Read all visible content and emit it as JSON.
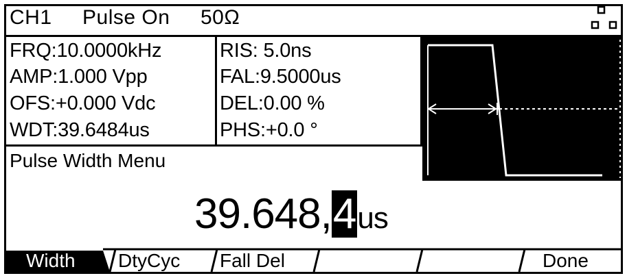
{
  "header": {
    "channel": "CH1",
    "mode": "Pulse On",
    "load": "50Ω"
  },
  "params": {
    "left": [
      {
        "key": "FRQ:",
        "value": "10.0000kHz"
      },
      {
        "key": "AMP:",
        "value": "1.000 Vpp"
      },
      {
        "key": "OFS:",
        "value": "+0.000 Vdc"
      },
      {
        "key": "WDT:",
        "value": "39.6484us"
      }
    ],
    "right": [
      {
        "key": "RIS:",
        "value": " 5.0ns"
      },
      {
        "key": "FAL:",
        "value": "9.5000us"
      },
      {
        "key": "DEL:",
        "value": "0.00 %"
      },
      {
        "key": "PHS:",
        "value": "+0.0 °"
      }
    ]
  },
  "menu": {
    "title": "Pulse Width Menu",
    "value_main": "39.648,",
    "value_cursor": "4",
    "value_unit": "us"
  },
  "softkeys": [
    {
      "label": "Width",
      "selected": true
    },
    {
      "label": "DtyCyc",
      "selected": false
    },
    {
      "label": "Fall Del",
      "selected": false
    },
    {
      "label": "",
      "selected": false
    },
    {
      "label": "",
      "selected": false
    },
    {
      "label": "Done",
      "selected": false
    }
  ],
  "colors": {
    "background": "#ffffff",
    "foreground": "#000000"
  }
}
